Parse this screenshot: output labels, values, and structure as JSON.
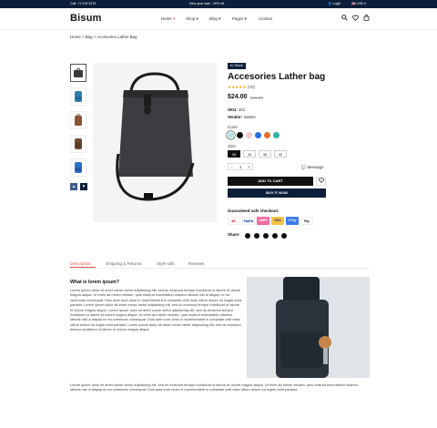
{
  "topbar": {
    "phone": "Call: +1 076 3376",
    "promo": "New year sale - 30% off",
    "login": "Login",
    "currency": "USD"
  },
  "header": {
    "logo": "Bisum",
    "menu": [
      "Home",
      "Shop",
      "Blog",
      "Pages",
      "Contact"
    ],
    "active_menu": "Home"
  },
  "breadcrumb": [
    "Home",
    "Bag",
    "Accesories Lather Bag"
  ],
  "product": {
    "badge": "In Stock",
    "title": "Accesories Lather bag",
    "rating_stars": "★★★★★",
    "rating_count": "(20)",
    "price": "$24.00",
    "old_price": "$40.00",
    "sku_label": "SKU:",
    "sku_value": "401",
    "vendor_label": "Vendor:",
    "vendor_value": "leather",
    "color_label": "Color:",
    "colors": [
      "#b7dde8",
      "#111111",
      "#f4c7c7",
      "#2a6fe0",
      "#e8702a",
      "#2bb7a8"
    ],
    "size_label": "Size:",
    "sizes": [
      "34",
      "36",
      "38",
      "40"
    ],
    "selected_size": "34",
    "qty": "1",
    "qty_minus": "-",
    "qty_plus": "+",
    "message": "Message",
    "add_to_cart": "ADD TO CART",
    "buy_now": "BUY IT NOW",
    "checkout_label": "Guaranteed safe checkout:",
    "payments": [
      "MC",
      "PayPal",
      "AMEX",
      "VISA",
      "G Pay",
      "Pay"
    ],
    "share_label": "Share:"
  },
  "tabs": [
    "Description",
    "Shipping & Returns",
    "Style with",
    "Reviews"
  ],
  "active_tab": "Description",
  "description": {
    "heading": "What is lorem ipsum?",
    "para1": "Lorem ipsum dolor sit amet conse ctetur adipisicing elit, sed do eiusmod tempor incididunt ut labore et dolore magna aliqua. Ut enim ad minim veniam, quis nostrud exercitation ullamco laboris nisi ut aliquip ex ea commodo consequat. Duis aute irure dolor in reprehenderit in voluptate velit esse cillum dolore eu fugiat nulla pariatur. Lorem ipsum dolor sit amet conse ctetur adipisicing elit, sed do eiusmod tempor incididunt ut labore et dolore magna aliqua. Lorem ipsum dolor sit amet conse ctetur adipisicing elit, sed do eiusmod tempor incididunt ut labore et dolore magna aliqua. Ut enim ad minim veniam, quis nostrud exercitation ullamco laboris nisi ut aliquip ex ea commodo consequat. Duis aute irure dolor in reprehenderit in voluptate velit esse cillum dolore eu fugiat nulla pariatur. Lorem ipsum dolor sit amet conse ctetur adipisicing elit, sed do eiusmod tempor incididunt ut labore et dolore magna aliqua.",
    "para2": "Lorem ipsum dolor sit amet conse ctetur adipisicing elit, sed do eiusmod tempor incididunt ut labore et dolore magna aliqua. Ut enim ad minim veniam, quis nostrud exercitation ullamco laboris nisi ut aliquip ex ea commodo consequat. Duis aute irure dolor in reprehenderit in voluptate velit esse cillum dolore eu fugiat nulla pariatur."
  }
}
